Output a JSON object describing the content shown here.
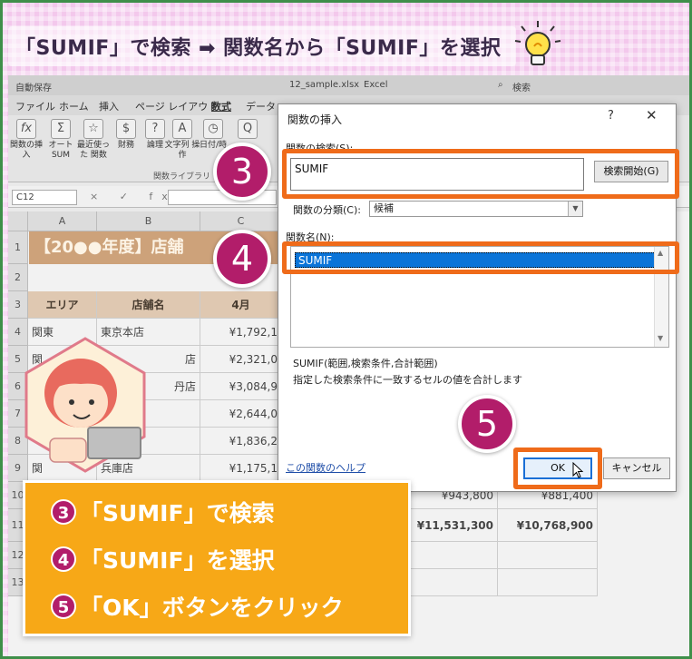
{
  "title": "「SUMIF」で検索 ➡ 関数名から「SUMIF」を選択",
  "excel": {
    "autosave": "自動保存",
    "filename": "12_sample.xlsx",
    "app": "Excel",
    "search": "検索",
    "tabs": [
      "ファイル",
      "ホーム",
      "挿入",
      "ページ レイアウト",
      "数式",
      "データ"
    ],
    "ribbon": [
      {
        "icon": "fx",
        "label": "関数の挿入"
      },
      {
        "icon": "Σ",
        "label": "オート SUM"
      },
      {
        "icon": "☆",
        "label": "最近使った 関数"
      },
      {
        "icon": "$",
        "label": "財務"
      },
      {
        "icon": "?",
        "label": "論理"
      },
      {
        "icon": "A",
        "label": "文字列 操作"
      },
      {
        "icon": "◷",
        "label": "日付/時"
      },
      {
        "icon": "Q",
        "label": ""
      }
    ],
    "ribbon_group": "関数ライブラリ",
    "name_box": "C12",
    "formula_icons": "× ✓ fx",
    "columns": [
      "A",
      "B",
      "C"
    ],
    "rows": [
      "1",
      "2",
      "3",
      "4",
      "5",
      "6",
      "7",
      "8",
      "9",
      "10",
      "11",
      "12",
      "13"
    ],
    "banner": "【20●●年度】店舗",
    "headers": {
      "area": "エリア",
      "store": "店舗名",
      "month": "4月"
    },
    "data_rows": [
      {
        "area": "関東",
        "store": "東京本店",
        "apr": "¥1,792,1"
      },
      {
        "area": "関",
        "store": "店",
        "apr": "¥2,321,0"
      },
      {
        "area": "",
        "store": "丹店",
        "apr": "¥3,084,9"
      },
      {
        "area": "",
        "store": "",
        "apr": "¥2,644,0"
      },
      {
        "area": "",
        "store": "",
        "apr": "¥1,836,2"
      },
      {
        "area": "関",
        "store": "兵庫店",
        "apr": "¥1,175,1"
      }
    ],
    "right_values": {
      "r10c1": "¥943,800",
      "r10c2": "¥881,400",
      "r11c1": "¥11,531,300",
      "r11c2": "¥10,768,900"
    }
  },
  "dialog": {
    "title": "関数の挿入",
    "help": "?",
    "close": "✕",
    "search_label": "関数の検索(S):",
    "search_value": "SUMIF",
    "search_button": "検索開始(G)",
    "category_label": "関数の分類(C):",
    "category_value": "候補",
    "fn_label": "関数名(N):",
    "fn_selected": "SUMIF",
    "syntax": "SUMIF(範囲,検索条件,合計範囲)",
    "description": "指定した検索条件に一致するセルの値を合計します",
    "help_link": "この関数のヘルプ",
    "ok": "OK",
    "cancel": "キャンセル"
  },
  "markers": [
    "3",
    "4",
    "5"
  ],
  "steps": [
    {
      "num": "3",
      "text": "「SUMIF」で検索"
    },
    {
      "num": "4",
      "text": "「SUMIF」を選択"
    },
    {
      "num": "5",
      "text": "「OK」ボタンをクリック"
    }
  ],
  "colors": {
    "accent_orange": "#ef6b1a",
    "marker_magenta": "#b21d6a",
    "steps_bg": "#f7a817",
    "selection_blue": "#0a74d8"
  }
}
